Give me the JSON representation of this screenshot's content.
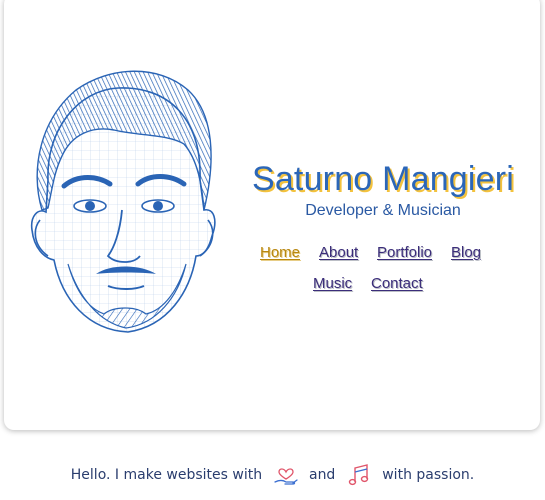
{
  "profile": {
    "name": "Saturno Mangieri",
    "subtitle": "Developer & Musician",
    "portrait_icon": "sketch-portrait"
  },
  "nav": {
    "items": [
      {
        "label": "Home",
        "active": true
      },
      {
        "label": "About",
        "active": false
      },
      {
        "label": "Portfolio",
        "active": false
      },
      {
        "label": "Blog",
        "active": false
      },
      {
        "label": "Music",
        "active": false
      },
      {
        "label": "Contact",
        "active": false
      }
    ]
  },
  "footer": {
    "prefix": "Hello. I make websites with",
    "middle": "and",
    "suffix": "with passion.",
    "icons": [
      "heart-hand-icon",
      "music-note-icon"
    ]
  },
  "colors": {
    "name": "#2b66b8",
    "name_shadow": "#f3c23d",
    "nav_link": "#3b2d7a",
    "nav_active": "#b8870f",
    "portrait_ink": "#2a64b5"
  }
}
